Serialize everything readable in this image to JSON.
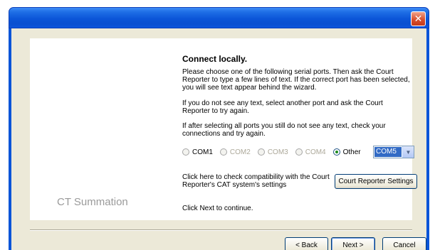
{
  "window": {
    "close_glyph": "✕"
  },
  "brand": "CT Summation",
  "wizard": {
    "heading": "Connect locally.",
    "para1": "Please choose one of the following serial ports. Then ask the Court Reporter to type a few lines of text. If the correct port has been selected, you will see text appear behind the wizard.",
    "para2": "If you do not see any text, select another port and ask the Court Reporter to try again.",
    "para3": "If after selecting all ports you still do not see any text, check your connections and try again.",
    "ports": [
      {
        "label": "COM1",
        "enabled": true,
        "checked": false
      },
      {
        "label": "COM2",
        "enabled": false,
        "checked": false
      },
      {
        "label": "COM3",
        "enabled": false,
        "checked": false
      },
      {
        "label": "COM4",
        "enabled": false,
        "checked": false
      },
      {
        "label": "Other",
        "enabled": true,
        "checked": true
      }
    ],
    "other_port_value": "COM5",
    "compat_text": "Click here to check compatibility with the Court Reporter's CAT system's settings",
    "compat_button": "Court Reporter Settings",
    "next_text": "Click Next to continue."
  },
  "buttons": {
    "back": "< Back",
    "next": "Next >",
    "cancel": "Cancel"
  }
}
